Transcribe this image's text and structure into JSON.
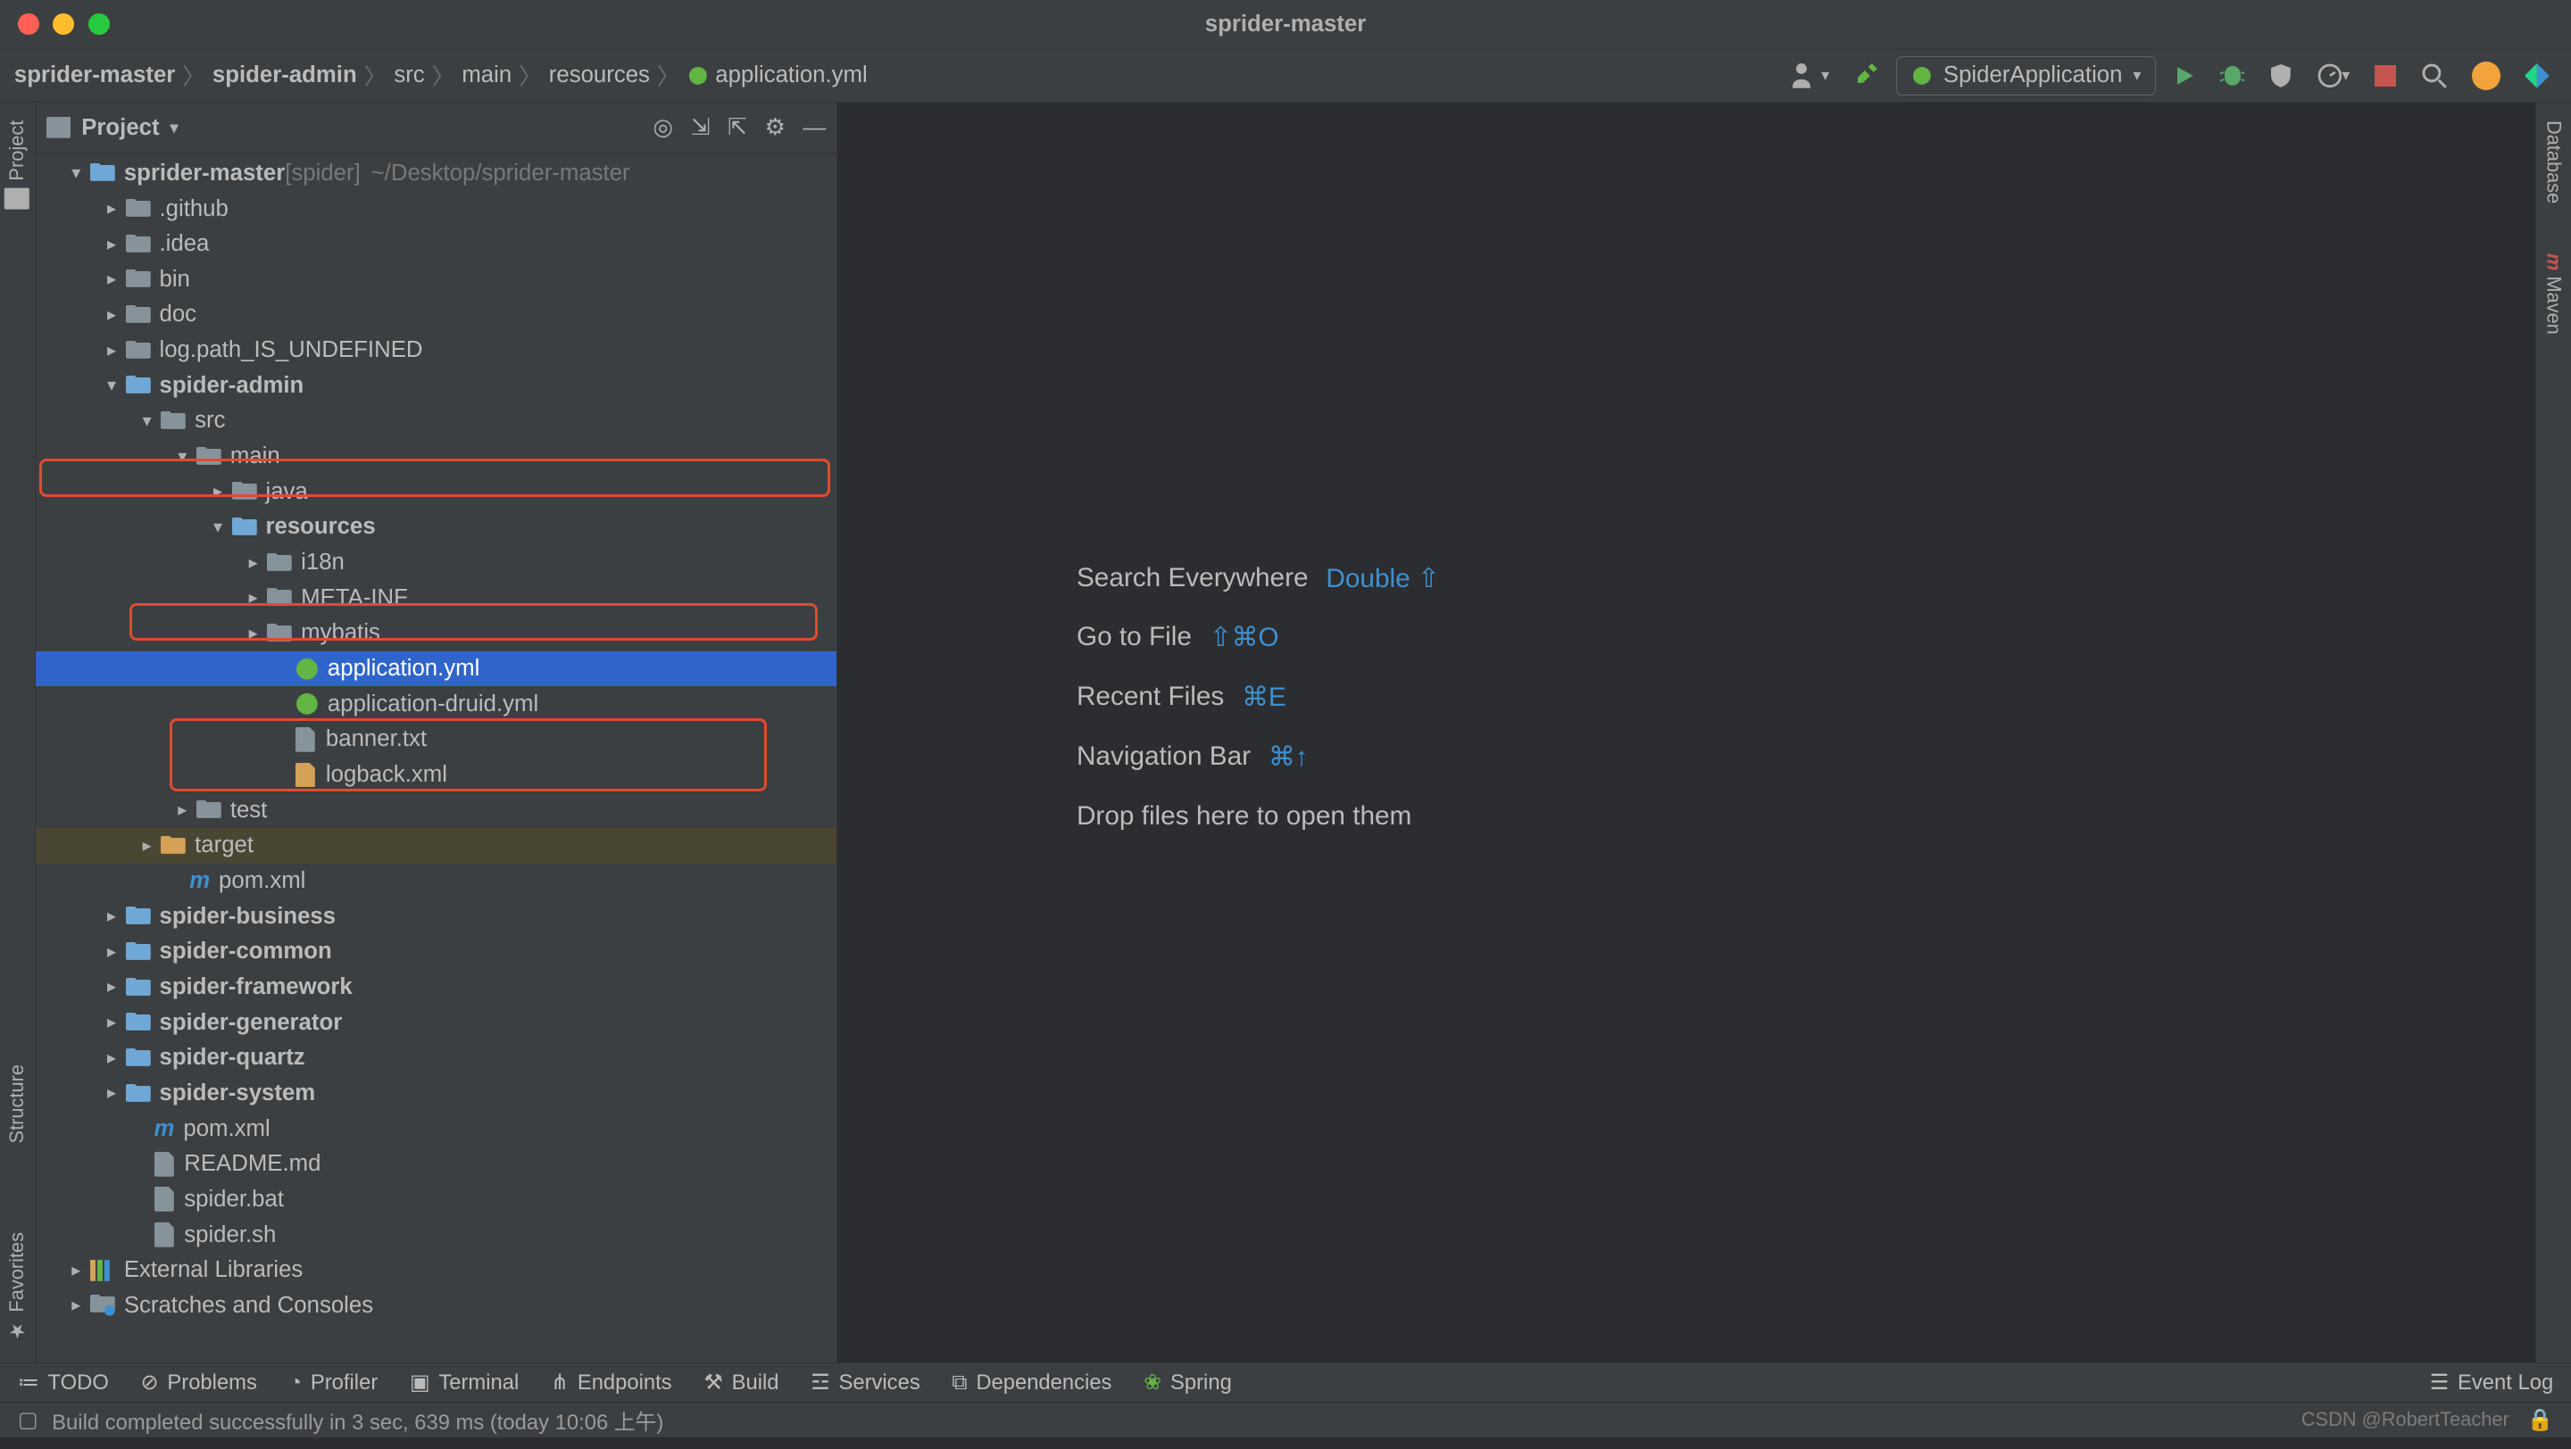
{
  "window": {
    "title": "sprider-master"
  },
  "breadcrumbs": [
    {
      "label": "sprider-master",
      "bold": true
    },
    {
      "label": "spider-admin",
      "bold": true
    },
    {
      "label": "src",
      "bold": false
    },
    {
      "label": "main",
      "bold": false
    },
    {
      "label": "resources",
      "bold": false
    },
    {
      "label": "application.yml",
      "bold": false
    }
  ],
  "run_config": {
    "label": "SpiderApplication"
  },
  "panel": {
    "title": "Project",
    "icons": [
      "target-icon",
      "sort-icon",
      "expand-icon",
      "gear-icon",
      "minimize-icon"
    ]
  },
  "tree": [
    {
      "ind": 15,
      "arrow": "▾",
      "icon": "folder-mod",
      "text": "sprider-master",
      "suffix": "[spider]",
      "hint": "~/Desktop/sprider-master",
      "bold": true
    },
    {
      "ind": 35,
      "arrow": "▸",
      "icon": "folder-sm",
      "text": ".github"
    },
    {
      "ind": 35,
      "arrow": "▸",
      "icon": "folder-sm",
      "text": ".idea"
    },
    {
      "ind": 35,
      "arrow": "▸",
      "icon": "folder-sm",
      "text": "bin"
    },
    {
      "ind": 35,
      "arrow": "▸",
      "icon": "folder-sm",
      "text": "doc"
    },
    {
      "ind": 35,
      "arrow": "▸",
      "icon": "folder-sm",
      "text": "log.path_IS_UNDEFINED"
    },
    {
      "ind": 35,
      "arrow": "▾",
      "icon": "folder-mod",
      "text": "spider-admin",
      "bold": true,
      "hl": 1
    },
    {
      "ind": 55,
      "arrow": "▾",
      "icon": "folder-sm",
      "text": "src"
    },
    {
      "ind": 75,
      "arrow": "▾",
      "icon": "folder-sm",
      "text": "main"
    },
    {
      "ind": 95,
      "arrow": "▸",
      "icon": "folder-sm",
      "text": "java"
    },
    {
      "ind": 95,
      "arrow": "▾",
      "icon": "folder-res",
      "text": "resources",
      "bold": true,
      "hl": 2
    },
    {
      "ind": 115,
      "arrow": "▸",
      "icon": "folder-sm",
      "text": "i18n"
    },
    {
      "ind": 115,
      "arrow": "▸",
      "icon": "folder-sm",
      "text": "META-INF"
    },
    {
      "ind": 115,
      "arrow": "▸",
      "icon": "folder-sm",
      "text": "mybatis",
      "hl": 3
    },
    {
      "ind": 131,
      "arrow": "",
      "icon": "spring-sm",
      "text": "application.yml",
      "selected": true,
      "hl": 3
    },
    {
      "ind": 131,
      "arrow": "",
      "icon": "spring-sm",
      "text": "application-druid.yml"
    },
    {
      "ind": 131,
      "arrow": "",
      "icon": "file-sm",
      "text": "banner.txt"
    },
    {
      "ind": 131,
      "arrow": "",
      "icon": "xml-sm",
      "text": "logback.xml"
    },
    {
      "ind": 75,
      "arrow": "▸",
      "icon": "folder-sm",
      "text": "test"
    },
    {
      "ind": 55,
      "arrow": "▸",
      "icon": "folder-tgt",
      "text": "target",
      "target": true
    },
    {
      "ind": 71,
      "arrow": "",
      "icon": "maven-sm",
      "text": "pom.xml"
    },
    {
      "ind": 35,
      "arrow": "▸",
      "icon": "folder-mod",
      "text": "spider-business",
      "bold": true
    },
    {
      "ind": 35,
      "arrow": "▸",
      "icon": "folder-mod",
      "text": "spider-common",
      "bold": true
    },
    {
      "ind": 35,
      "arrow": "▸",
      "icon": "folder-mod",
      "text": "spider-framework",
      "bold": true
    },
    {
      "ind": 35,
      "arrow": "▸",
      "icon": "folder-mod",
      "text": "spider-generator",
      "bold": true
    },
    {
      "ind": 35,
      "arrow": "▸",
      "icon": "folder-mod",
      "text": "spider-quartz",
      "bold": true
    },
    {
      "ind": 35,
      "arrow": "▸",
      "icon": "folder-mod",
      "text": "spider-system",
      "bold": true
    },
    {
      "ind": 51,
      "arrow": "",
      "icon": "maven-sm",
      "text": "pom.xml"
    },
    {
      "ind": 51,
      "arrow": "",
      "icon": "file-sm",
      "text": "README.md"
    },
    {
      "ind": 51,
      "arrow": "",
      "icon": "file-sm",
      "text": "spider.bat"
    },
    {
      "ind": 51,
      "arrow": "",
      "icon": "file-sm",
      "text": "spider.sh"
    },
    {
      "ind": 15,
      "arrow": "▸",
      "icon": "libs",
      "text": "External Libraries"
    },
    {
      "ind": 15,
      "arrow": "▸",
      "icon": "scratch",
      "text": "Scratches and Consoles"
    }
  ],
  "welcome": {
    "search": {
      "label": "Search Everywhere",
      "shortcut": "Double ⇧"
    },
    "goto": {
      "label": "Go to File",
      "shortcut": "⇧⌘O"
    },
    "recent": {
      "label": "Recent Files",
      "shortcut": "⌘E"
    },
    "navbar": {
      "label": "Navigation Bar",
      "shortcut": "⌘↑"
    },
    "drop": {
      "label": "Drop files here to open them"
    }
  },
  "left_tabs": [
    "Project",
    "Structure",
    "Favorites"
  ],
  "right_tabs": [
    "Database",
    "Maven"
  ],
  "bottom_tabs": [
    "TODO",
    "Problems",
    "Profiler",
    "Terminal",
    "Endpoints",
    "Build",
    "Services",
    "Dependencies",
    "Spring"
  ],
  "event_log": "Event Log",
  "status": {
    "msg": "Build completed successfully in 3 sec, 639 ms (today 10:06 上午)",
    "watermark": "CSDN @RobertTeacher"
  }
}
